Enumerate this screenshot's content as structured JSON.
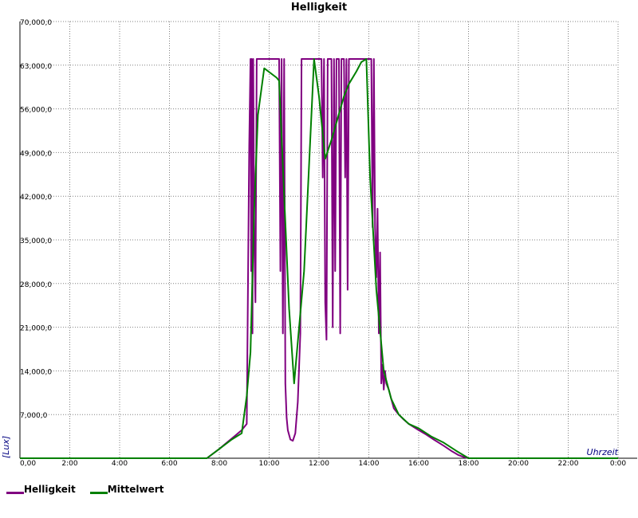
{
  "chart_data": {
    "type": "line",
    "title": "Helligkeit",
    "xlabel": "Uhrzeit",
    "ylabel": "[Lux]",
    "xlim": [
      0,
      24
    ],
    "ylim": [
      0,
      70000
    ],
    "grid": true,
    "legend_position": "bottom-left",
    "x_tick_labels": [
      "0,00",
      "2:00",
      "4:00",
      "6:00",
      "8:00",
      "10:00",
      "12:00",
      "14:00",
      "16:00",
      "18:00",
      "20:00",
      "22:00",
      "0:00"
    ],
    "y_tick_labels": [
      "70,000,0",
      "63,000,0",
      "56,000,0",
      "49,000,0",
      "42,000,0",
      "35,000,0",
      "28,000,0",
      "21,000,0",
      "14,000,0",
      "7,000,0",
      ""
    ],
    "series": [
      {
        "name": "Helligkeit",
        "color": "#800080",
        "x": [
          0,
          7.5,
          8.0,
          8.3,
          8.6,
          8.9,
          9.1,
          9.2,
          9.25,
          9.28,
          9.3,
          9.33,
          9.36,
          9.4,
          9.45,
          9.5,
          9.55,
          9.6,
          9.65,
          9.7,
          9.75,
          9.8,
          9.85,
          9.9,
          10.0,
          10.2,
          10.4,
          10.45,
          10.5,
          10.55,
          10.6,
          10.65,
          10.7,
          10.75,
          10.85,
          10.95,
          11.05,
          11.15,
          11.25,
          11.3,
          11.35,
          11.4,
          11.45,
          11.5,
          11.6,
          11.7,
          11.8,
          11.9,
          12.0,
          12.1,
          12.15,
          12.2,
          12.25,
          12.3,
          12.35,
          12.4,
          12.5,
          12.55,
          12.6,
          12.65,
          12.7,
          12.75,
          12.8,
          12.85,
          12.9,
          12.95,
          13.0,
          13.05,
          13.1,
          13.15,
          13.2,
          13.25,
          13.3,
          13.35,
          13.4,
          13.5,
          13.55,
          13.6,
          13.7,
          13.8,
          13.9,
          14.0,
          14.05,
          14.1,
          14.15,
          14.2,
          14.25,
          14.3,
          14.35,
          14.4,
          14.45,
          14.5,
          14.55,
          14.6,
          14.65,
          14.7,
          14.75,
          14.8,
          14.9,
          15.0,
          15.2,
          15.4,
          15.6,
          15.8,
          16.0,
          16.3,
          16.6,
          17.0,
          17.3,
          17.6,
          17.8,
          18.0,
          24
        ],
        "values": [
          0,
          0,
          1500,
          2500,
          3500,
          4500,
          5500,
          50000,
          64000,
          30000,
          64000,
          20000,
          64000,
          35000,
          25000,
          64000,
          64000,
          64000,
          64000,
          64000,
          64000,
          64000,
          64000,
          64000,
          64000,
          64000,
          64000,
          30000,
          64000,
          20000,
          64000,
          12000,
          6500,
          4500,
          3000,
          2800,
          4000,
          9000,
          20000,
          64000,
          64000,
          64000,
          64000,
          64000,
          64000,
          64000,
          64000,
          64000,
          64000,
          64000,
          45000,
          64000,
          25000,
          19000,
          64000,
          64000,
          64000,
          21000,
          64000,
          30000,
          64000,
          64000,
          64000,
          20000,
          64000,
          64000,
          64000,
          45000,
          64000,
          27000,
          64000,
          64000,
          64000,
          64000,
          64000,
          64000,
          64000,
          64000,
          64000,
          64000,
          64000,
          64000,
          64000,
          64000,
          37000,
          64000,
          37000,
          29000,
          40000,
          20000,
          33000,
          12000,
          15000,
          11000,
          14000,
          12000,
          11500,
          11000,
          9500,
          8000,
          7000,
          6200,
          5500,
          5000,
          4500,
          3800,
          3000,
          2000,
          1200,
          500,
          200,
          0,
          0
        ]
      },
      {
        "name": "Mittelwert",
        "color": "#008000",
        "x": [
          0,
          7.5,
          8.0,
          8.5,
          8.9,
          9.1,
          9.25,
          9.4,
          9.55,
          9.8,
          10.3,
          10.4,
          10.8,
          11.0,
          11.4,
          11.8,
          12.0,
          12.25,
          12.5,
          13.0,
          13.2,
          13.5,
          13.7,
          13.9,
          14.05,
          14.3,
          14.6,
          14.9,
          15.2,
          15.6,
          16.0,
          16.5,
          17.0,
          17.5,
          18.0,
          24
        ],
        "values": [
          0,
          0,
          1500,
          3000,
          4000,
          10000,
          17000,
          40000,
          55000,
          62500,
          61000,
          60500,
          24000,
          12000,
          30000,
          64000,
          58000,
          48000,
          51000,
          58000,
          60000,
          62000,
          63500,
          64000,
          45000,
          27000,
          14000,
          9500,
          7000,
          5500,
          4800,
          3500,
          2500,
          1200,
          0,
          0
        ]
      }
    ]
  }
}
